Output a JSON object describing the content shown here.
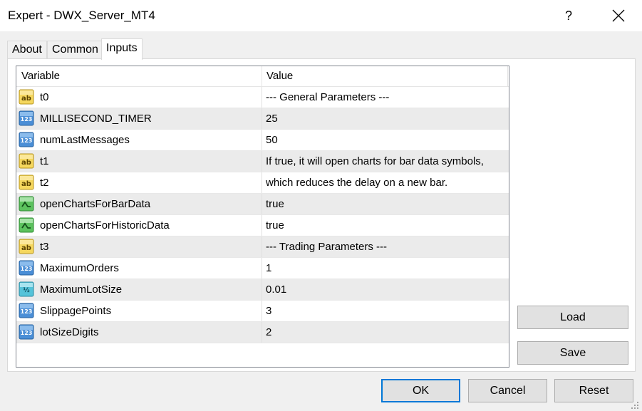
{
  "window": {
    "title": "Expert - DWX_Server_MT4",
    "help_label": "?"
  },
  "tabs": [
    {
      "label": "About"
    },
    {
      "label": "Common"
    },
    {
      "label": "Inputs"
    }
  ],
  "grid": {
    "headers": {
      "variable": "Variable",
      "value": "Value"
    },
    "rows": [
      {
        "icon": "ab-string-icon",
        "name": "t0",
        "value": "--- General Parameters ---"
      },
      {
        "icon": "123-integer-icon",
        "name": "MILLISECOND_TIMER",
        "value": "25"
      },
      {
        "icon": "123-integer-icon",
        "name": "numLastMessages",
        "value": "50"
      },
      {
        "icon": "ab-string-icon",
        "name": "t1",
        "value": "If true, it will open charts for bar data symbols,"
      },
      {
        "icon": "ab-string-icon",
        "name": "t2",
        "value": "which reduces the delay on a new bar."
      },
      {
        "icon": "bool-toggle-icon",
        "name": "openChartsForBarData",
        "value": "true"
      },
      {
        "icon": "bool-toggle-icon",
        "name": "openChartsForHistoricData",
        "value": "true"
      },
      {
        "icon": "ab-string-icon",
        "name": "t3",
        "value": "--- Trading Parameters ---"
      },
      {
        "icon": "123-integer-icon",
        "name": "MaximumOrders",
        "value": "1"
      },
      {
        "icon": "fraction-double-icon",
        "name": "MaximumLotSize",
        "value": "0.01"
      },
      {
        "icon": "123-integer-icon",
        "name": "SlippagePoints",
        "value": "3"
      },
      {
        "icon": "123-integer-icon",
        "name": "lotSizeDigits",
        "value": "2"
      }
    ]
  },
  "buttons": {
    "load": "Load",
    "save": "Save",
    "ok": "OK",
    "cancel": "Cancel",
    "reset": "Reset"
  },
  "colors": {
    "accent": "#0078d7",
    "string_icon": "#e8c84a",
    "int_icon": "#3a7cc4",
    "bool_icon": "#3aa64a",
    "double_icon": "#3aa6c4"
  }
}
